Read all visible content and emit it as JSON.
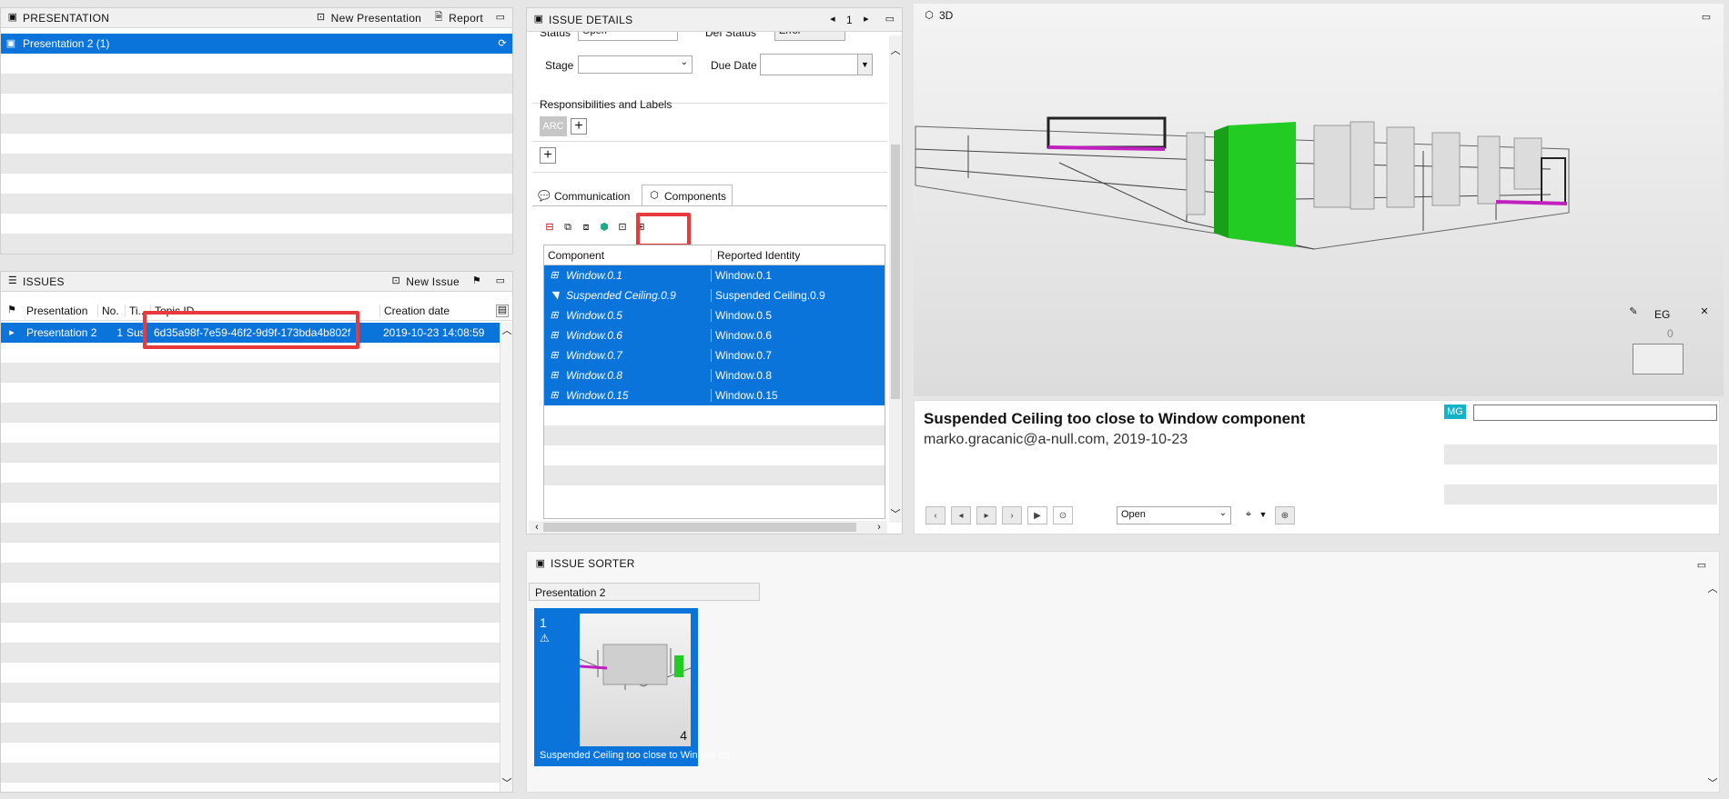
{
  "presentation_panel": {
    "title": "PRESENTATION",
    "new_presentation": "New Presentation",
    "report": "Report",
    "selected_item": "Presentation 2 (1)"
  },
  "issues_panel": {
    "title": "ISSUES",
    "new_issue": "New Issue",
    "columns": [
      "Presentation",
      "No.",
      "Ti...",
      "Topic ID",
      "Creation date"
    ],
    "row": {
      "presentation": "Presentation 2",
      "no": "1",
      "title": "Sus",
      "topic_id": "6d35a98f-7e59-46f2-9d9f-173bda4b802f",
      "creation_date": "2019-10-23 14:08:59"
    }
  },
  "issue_details": {
    "title": "ISSUE DETAILS",
    "page": "1",
    "status_label": "Status",
    "status_value": "Open",
    "def_status_label": "Def Status",
    "def_status_value": "Error",
    "stage_label": "Stage",
    "stage_value": "",
    "due_date_label": "Due Date",
    "due_date_value": "",
    "responsibilities_title": "Responsibilities and Labels",
    "responsibility_tag": "ARC",
    "tabs": [
      "Communication",
      "Components"
    ],
    "table_headers": [
      "Component",
      "Reported Identity"
    ],
    "components": [
      {
        "component": "Window.0.1",
        "identity": "Window.0.1",
        "icon": "window-icon"
      },
      {
        "component": "Suspended Ceiling.0.9",
        "identity": "Suspended Ceiling.0.9",
        "icon": "ceiling-icon"
      },
      {
        "component": "Window.0.5",
        "identity": "Window.0.5",
        "icon": "window-icon"
      },
      {
        "component": "Window.0.6",
        "identity": "Window.0.6",
        "icon": "window-icon"
      },
      {
        "component": "Window.0.7",
        "identity": "Window.0.7",
        "icon": "window-icon"
      },
      {
        "component": "Window.0.8",
        "identity": "Window.0.8",
        "icon": "window-icon"
      },
      {
        "component": "Window.0.15",
        "identity": "Window.0.15",
        "icon": "window-icon"
      }
    ]
  },
  "view3d": {
    "title": "3D",
    "floor_label": "EG",
    "floor_number": "0"
  },
  "issue_info": {
    "title": "Suspended Ceiling too close to Window component",
    "author_date": "marko.gracanic@a-null.com, 2019-10-23",
    "status_select": "Open",
    "user_badge": "MG"
  },
  "issue_sorter": {
    "title": "ISSUE SORTER",
    "group": "Presentation 2",
    "card": {
      "number": "1",
      "count": "4",
      "caption": "Suspended Ceiling too close to Window co..."
    }
  },
  "colors": {
    "selection": "#0a74da",
    "highlight_red": "#e8393d",
    "model_green": "#22cc22",
    "model_magenta": "#c020c0",
    "badge_teal": "#16b3c8"
  }
}
